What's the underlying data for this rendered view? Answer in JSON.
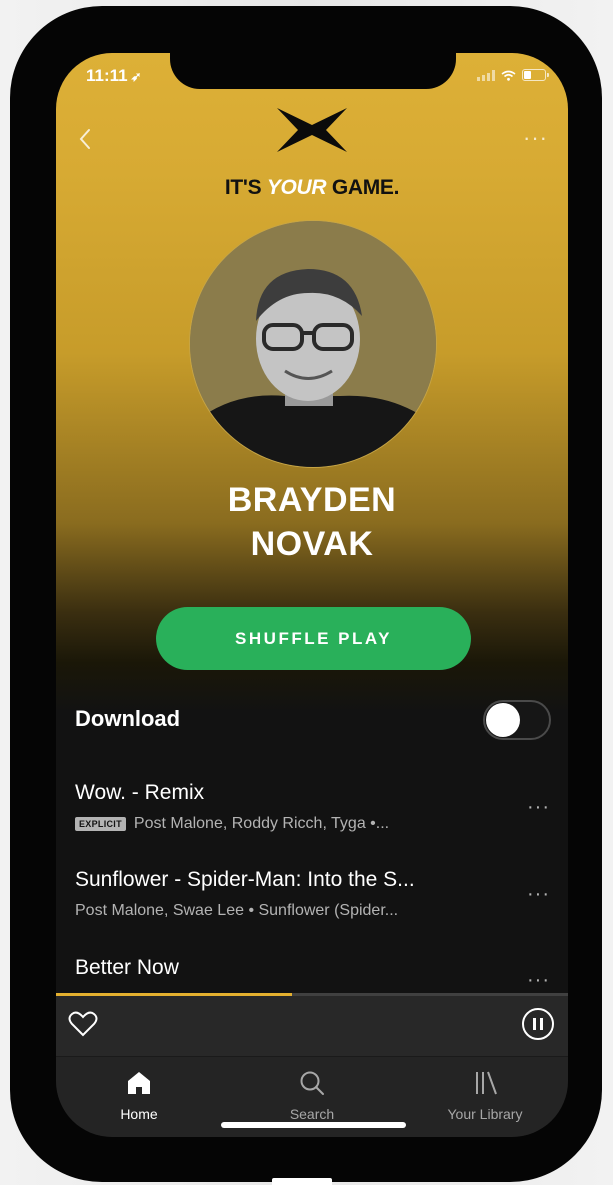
{
  "status_bar": {
    "time": "11:11",
    "location_arrow": "location-arrow-icon"
  },
  "header": {
    "logo": "x-brand-logo",
    "tagline_prefix": "IT'S ",
    "tagline_highlight": "YOUR",
    "tagline_suffix": " GAME."
  },
  "artist": {
    "name_line1": "BRAYDEN",
    "name_line2": "NOVAK"
  },
  "actions": {
    "shuffle_label": "SHUFFLE PLAY"
  },
  "download": {
    "label": "Download",
    "enabled": false
  },
  "tracks": [
    {
      "title": "Wow. - Remix",
      "explicit_label": "EXPLICIT",
      "subtitle": "Post Malone, Roddy Ricch, Tyga •..."
    },
    {
      "title": "Sunflower - Spider-Man: Into the S...",
      "subtitle": "Post Malone, Swae Lee • Sunflower (Spider..."
    },
    {
      "title": "Better Now"
    }
  ],
  "now_playing": {
    "progress": 0.46,
    "accent": "#e4b02f"
  },
  "tabs": [
    {
      "label": "Home",
      "icon": "home-icon",
      "active": true
    },
    {
      "label": "Search",
      "icon": "search-icon",
      "active": false
    },
    {
      "label": "Your Library",
      "icon": "library-icon",
      "active": false
    }
  ],
  "colors": {
    "accent_green": "#29b05a",
    "header_gold": "#ddb037",
    "background_dark": "#121212"
  }
}
